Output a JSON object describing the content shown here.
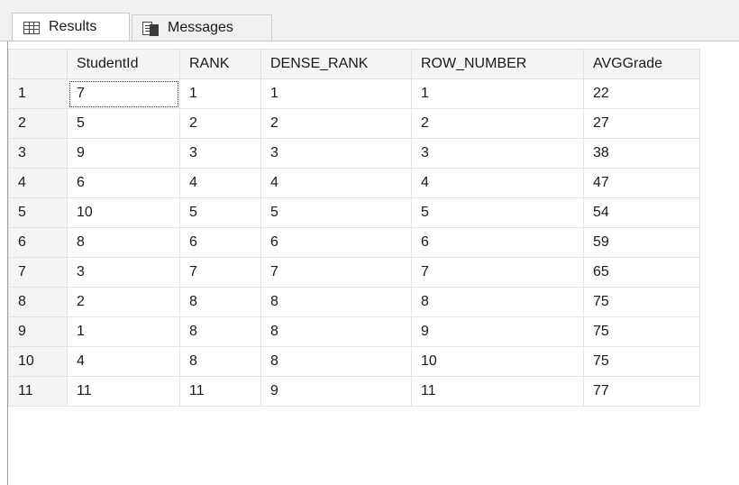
{
  "tabs": [
    {
      "label": "Results",
      "icon": "grid-icon"
    },
    {
      "label": "Messages",
      "icon": "messages-icon"
    }
  ],
  "table": {
    "columns": [
      "StudentId",
      "RANK",
      "DENSE_RANK",
      "ROW_NUMBER",
      "AVGGrade"
    ],
    "rows": [
      [
        "1",
        "7",
        "1",
        "1",
        "1",
        "22"
      ],
      [
        "2",
        "5",
        "2",
        "2",
        "2",
        "27"
      ],
      [
        "3",
        "9",
        "3",
        "3",
        "3",
        "38"
      ],
      [
        "4",
        "6",
        "4",
        "4",
        "4",
        "47"
      ],
      [
        "5",
        "10",
        "5",
        "5",
        "5",
        "54"
      ],
      [
        "6",
        "8",
        "6",
        "6",
        "6",
        "59"
      ],
      [
        "7",
        "3",
        "7",
        "7",
        "7",
        "65"
      ],
      [
        "8",
        "2",
        "8",
        "8",
        "8",
        "75"
      ],
      [
        "9",
        "1",
        "8",
        "8",
        "9",
        "75"
      ],
      [
        "10",
        "4",
        "8",
        "8",
        "10",
        "75"
      ],
      [
        "11",
        "11",
        "11",
        "9",
        "11",
        "77"
      ]
    ]
  }
}
